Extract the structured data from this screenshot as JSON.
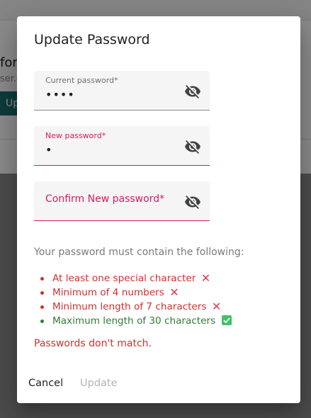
{
  "background": {
    "title_fragment": "for",
    "subtitle_fragment": "ser.c",
    "button_fragment": "Up"
  },
  "dialog": {
    "title": "Update Password",
    "fields": [
      {
        "label": "Current password*",
        "value": "••••",
        "error": false,
        "icon": "eye-off-icon"
      },
      {
        "label": "New password*",
        "value": "•",
        "error": true,
        "icon": "eye-off-icon"
      },
      {
        "label": "Confirm New password*",
        "value": "",
        "error": true,
        "icon": "eye-off-icon"
      }
    ],
    "requirements_intro": "Your password must contain the following:",
    "requirements": [
      {
        "text": "At least one special character",
        "met": false
      },
      {
        "text": "Minimum of 4 numbers",
        "met": false
      },
      {
        "text": "Minimum length of 7 characters",
        "met": false
      },
      {
        "text": "Maximum length of 30 characters",
        "met": true
      }
    ],
    "error_message": "Passwords don't match.",
    "buttons": {
      "cancel": "Cancel",
      "update": "Update"
    }
  },
  "colors": {
    "error": "#d32f2f",
    "field_error_accent": "#d81b60",
    "success": "#2e7d32",
    "check_badge": "#43c167",
    "x_mark": "#e53950",
    "teal_button": "#1b6e70"
  }
}
